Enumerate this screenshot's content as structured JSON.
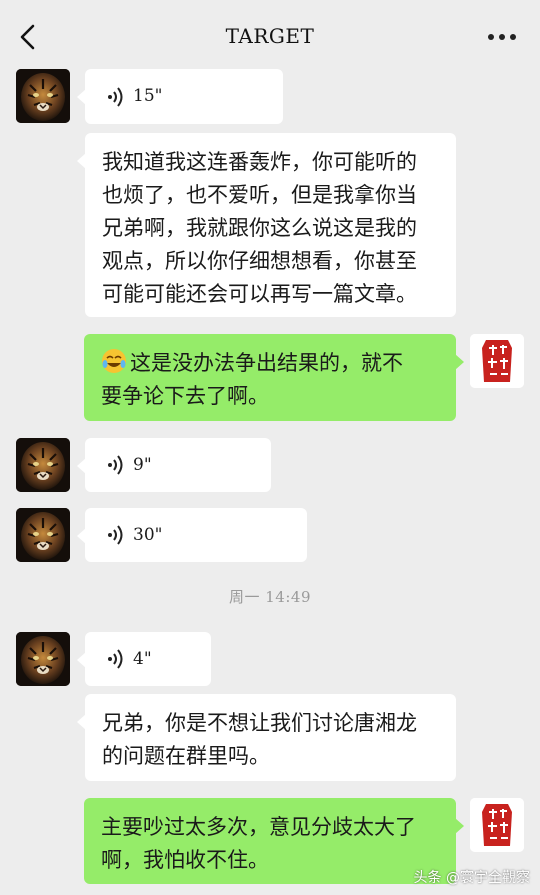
{
  "header": {
    "title": "TARGET",
    "back_icon": "chevron-left-icon",
    "more_icon": "more-dots-icon"
  },
  "messages": [
    {
      "type": "voice",
      "side": "left",
      "duration": "15\""
    },
    {
      "type": "text",
      "side": "left",
      "lines": [
        "我知道我这连番轰炸，你可能听的",
        "也烦了，也不爱听，但是我拿你当",
        "兄弟啊，我就跟你这么说这是我的",
        "观点，所以你仔细想想看，你甚至",
        "可能可能还会可以再写一篇文章。"
      ]
    },
    {
      "type": "text",
      "side": "right",
      "emoji": "laughing-crying-emoji",
      "lines": [
        "这是没办法争出结果的，就不",
        "要争论下去了啊。"
      ]
    },
    {
      "type": "voice",
      "side": "left",
      "duration": "9\""
    },
    {
      "type": "voice",
      "side": "left",
      "duration": "30\""
    },
    {
      "type": "voice",
      "side": "left",
      "duration": "4\""
    },
    {
      "type": "text",
      "side": "left",
      "lines": [
        "兄弟，你是不想让我们讨论唐湘龙",
        "的问题在群里吗。"
      ]
    },
    {
      "type": "text",
      "side": "right",
      "lines": [
        "主要吵过太多次，意见分歧太大了",
        "啊，我怕收不住。"
      ]
    }
  ],
  "timestamp": "周一 14:49",
  "watermark": "头条 @寰宇全觀察",
  "colors": {
    "background": "#ededed",
    "my_bubble": "#95ec69",
    "their_bubble": "#ffffff"
  }
}
